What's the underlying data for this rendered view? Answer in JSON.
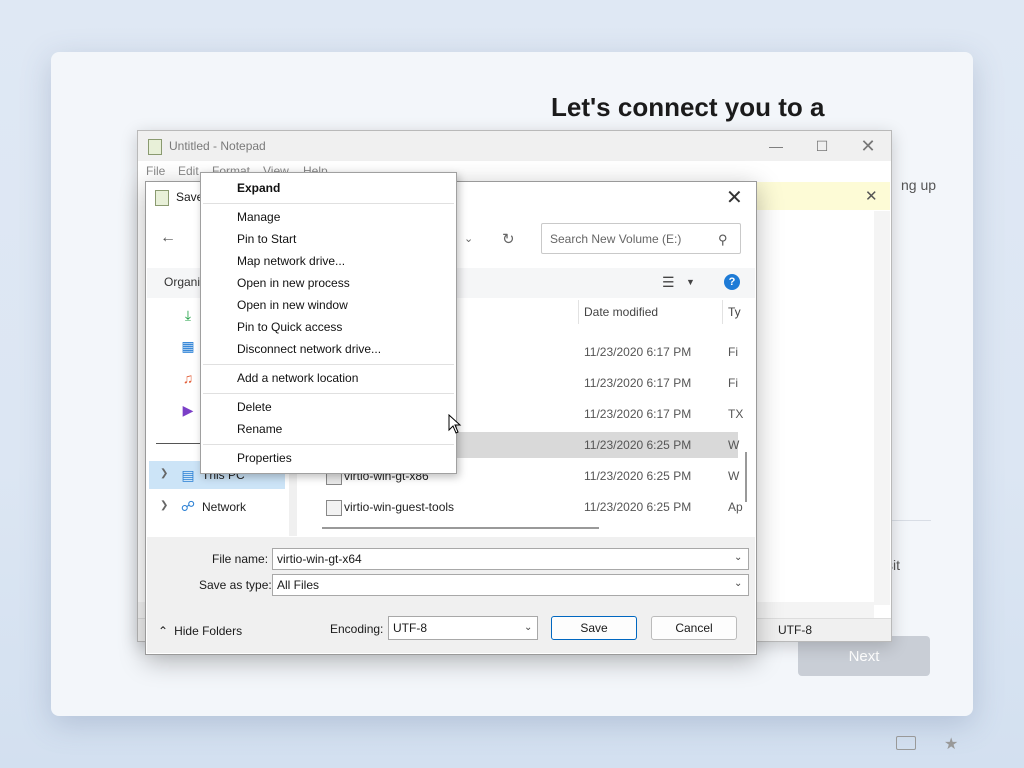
{
  "oobe": {
    "title": "Let's connect you to a",
    "side_text_top": "ng up",
    "side_text_mid": "sit",
    "next_label": "Next"
  },
  "notepad": {
    "title": "Untitled - Notepad",
    "menu": [
      "File",
      "Edit",
      "Format",
      "View",
      "Help"
    ],
    "status_encoding": "UTF-8"
  },
  "save_dialog": {
    "title": "Save",
    "search_placeholder": "Search New Volume (E:)",
    "organize_label": "Organi",
    "columns": {
      "date": "Date modified",
      "type": "Ty"
    },
    "nav": {
      "this_pc": "This PC",
      "network": "Network"
    },
    "rows": [
      {
        "name": "",
        "date": "11/23/2020 6:17 PM",
        "type": "Fi"
      },
      {
        "name": "",
        "date": "11/23/2020 6:17 PM",
        "type": "Fi"
      },
      {
        "name": "",
        "date": "11/23/2020 6:17 PM",
        "type": "TX"
      },
      {
        "name": "",
        "date": "11/23/2020 6:25 PM",
        "type": "W"
      },
      {
        "name": "virtio-win-gt-x86",
        "date": "11/23/2020 6:25 PM",
        "type": "W"
      },
      {
        "name": "virtio-win-guest-tools",
        "date": "11/23/2020 6:25 PM",
        "type": "Ap"
      }
    ],
    "file_name_label": "File name:",
    "file_name_value": "virtio-win-gt-x64",
    "save_type_label": "Save as type:",
    "save_type_value": "All Files",
    "hide_folders_label": "Hide Folders",
    "encoding_label": "Encoding:",
    "encoding_value": "UTF-8",
    "save_label": "Save",
    "cancel_label": "Cancel"
  },
  "context_menu": {
    "expand": "Expand",
    "manage": "Manage",
    "pin_to_start": "Pin to Start",
    "map_network_drive": "Map network drive...",
    "open_new_process": "Open in new process",
    "open_new_window": "Open in new window",
    "pin_quick_access": "Pin to Quick access",
    "disconnect_network_drive": "Disconnect network drive...",
    "add_network_location": "Add a network location",
    "delete": "Delete",
    "rename": "Rename",
    "properties": "Properties"
  },
  "colors": {
    "accent": "#0067c0",
    "selection": "#cce4f7",
    "help": "#1e7bd6"
  }
}
